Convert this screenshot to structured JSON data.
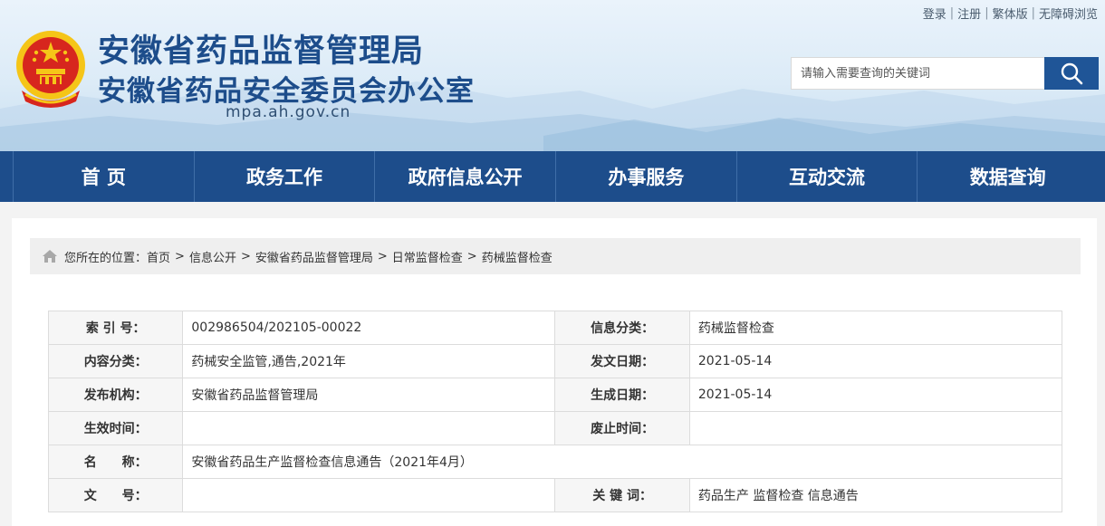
{
  "header": {
    "title_main": "安徽省药品监督管理局",
    "title_sub": "安徽省药品安全委员会办公室",
    "domain": "mpa.ah.gov.cn",
    "top_links": [
      "登录",
      "注册",
      "繁体版",
      "无障碍浏览"
    ],
    "search_placeholder": "请输入需要查询的关键词",
    "emblem_icon": "national-emblem-icon",
    "search_icon": "search-icon"
  },
  "nav": {
    "items": [
      "首 页",
      "政务工作",
      "政府信息公开",
      "办事服务",
      "互动交流",
      "数据查询"
    ]
  },
  "breadcrumb": {
    "prefix": "您所在的位置：",
    "items": [
      "首页",
      "信息公开",
      "安徽省药品监督管理局",
      "日常监督检查",
      "药械监督检查"
    ],
    "separator": ">"
  },
  "info": {
    "index_label": "索 引 号：",
    "index_value": "002986504/202105-00022",
    "category_label": "信息分类：",
    "category_value": "药械监督检查",
    "content_label": "内容分类：",
    "content_value": "药械安全监管,通告,2021年",
    "issue_label": "发文日期：",
    "issue_value": "2021-05-14",
    "publisher_label": "发布机构：",
    "publisher_value": "安徽省药品监督管理局",
    "generated_label": "生成日期：",
    "generated_value": "2021-05-14",
    "effective_label": "生效时间：",
    "effective_value": "",
    "expiry_label": "废止时间：",
    "expiry_value": "",
    "name_label": "名　　称：",
    "name_value": "安徽省药品生产监督检查信息通告（2021年4月）",
    "docno_label": "文　　号：",
    "docno_value": "",
    "keywords_label": "关 键 词：",
    "keywords_value": "药品生产 监督检查 信息通告"
  },
  "colors": {
    "brand_blue": "#1d4d8b",
    "search_button": "#1f5597",
    "emblem_red": "#d7261e",
    "emblem_gold": "#f5c518"
  }
}
